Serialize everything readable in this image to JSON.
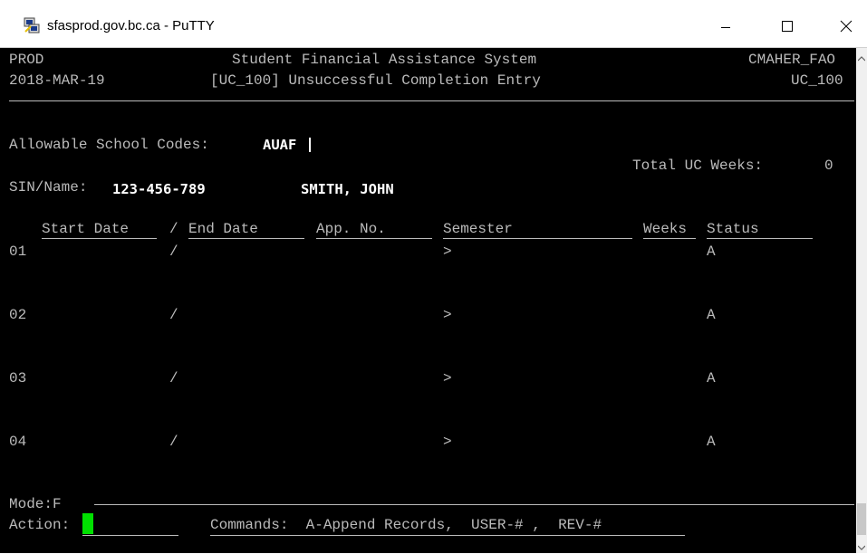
{
  "window": {
    "title": "sfasprod.gov.bc.ca - PuTTY",
    "icon": "putty-icon",
    "controls": [
      "minimize-icon",
      "maximize-icon",
      "close-icon"
    ]
  },
  "header": {
    "env": "PROD",
    "system_title": "Student Financial Assistance System",
    "user": "CMAHER_FAO",
    "date": "2018-MAR-19",
    "screen_title": "[UC_100] Unsuccessful Completion Entry",
    "screen_code": "UC_100"
  },
  "fields": {
    "school_codes_label": "Allowable School Codes:",
    "school_codes_value": "AUAF",
    "total_uc_weeks_label": "Total UC Weeks:",
    "total_uc_weeks_value": "0",
    "sin_label": "SIN/Name:",
    "sin_value": "123-456-789",
    "name_value": "SMITH, JOHN"
  },
  "table": {
    "columns": {
      "start_date": "Start Date",
      "sep": "/",
      "end_date": "End Date",
      "app_no": "App. No.",
      "semester": "Semester",
      "weeks": "Weeks",
      "status": "Status"
    },
    "rows": [
      {
        "num": "01",
        "sep": "/",
        "semester": ">",
        "status": "A"
      },
      {
        "num": "02",
        "sep": "/",
        "semester": ">",
        "status": "A"
      },
      {
        "num": "03",
        "sep": "/",
        "semester": ">",
        "status": "A"
      },
      {
        "num": "04",
        "sep": "/",
        "semester": ">",
        "status": "A"
      }
    ]
  },
  "footer": {
    "mode": "Mode:F",
    "action_label": "Action:",
    "commands": "Commands:  A-Append Records,  USER-# ,  REV-#"
  },
  "colors": {
    "terminal_bg": "#000000",
    "terminal_fg": "#bbbbbb",
    "bold_fg": "#ffffff",
    "cursor": "#00e000"
  }
}
